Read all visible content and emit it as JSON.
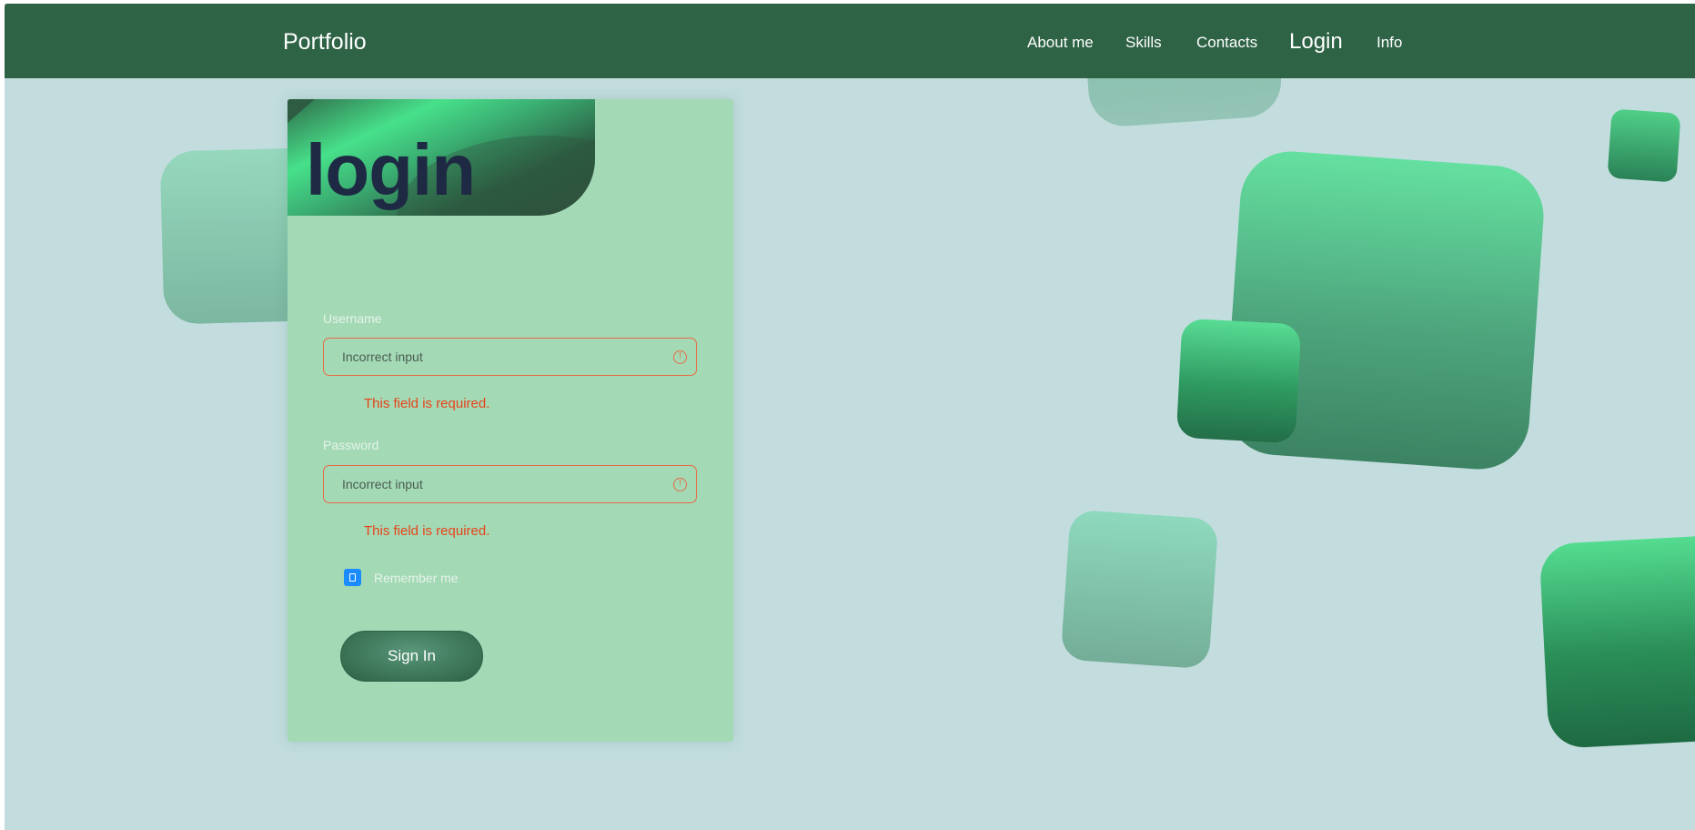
{
  "navbar": {
    "brand": "Portfolio",
    "links": [
      {
        "label": "About me"
      },
      {
        "label": "Skills"
      },
      {
        "label": "Contacts"
      },
      {
        "label": "Login",
        "active": true
      },
      {
        "label": "Info"
      }
    ]
  },
  "login_card": {
    "title": "login",
    "username": {
      "label": "Username",
      "placeholder": "Incorrect input",
      "error": "This field is required."
    },
    "password": {
      "label": "Password",
      "placeholder": "Incorrect input",
      "error": "This field is required."
    },
    "remember_me": {
      "label": "Remember me",
      "checked": true
    },
    "submit_label": "Sign In"
  },
  "colors": {
    "navbar": "#2e6346",
    "page_background": "#c3dddf",
    "card_background": "#a3d9b5",
    "error": "#e8431a",
    "title_text": "#1e2a44",
    "checkbox": "#1a8cff"
  },
  "icons": {
    "input_warning": "exclamation-circle-icon",
    "checkbox_mark": "check-icon"
  }
}
